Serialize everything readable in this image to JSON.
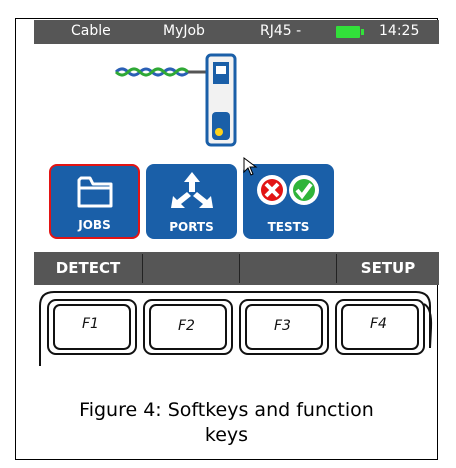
{
  "status_bar": {
    "items": [
      "Cable",
      "MyJob",
      "RJ45 -",
      "14:25"
    ],
    "battery_color": "#32e03a"
  },
  "tiles": [
    {
      "label": "JOBS",
      "icon": "folder-icon",
      "selected": true
    },
    {
      "label": "PORTS",
      "icon": "network-arrows-icon",
      "selected": false
    },
    {
      "label": "TESTS",
      "icon": "pass-fail-icon",
      "selected": false
    }
  ],
  "softkeys": [
    "DETECT",
    "",
    "",
    "SETUP"
  ],
  "function_keys": [
    "F1",
    "F2",
    "F3",
    "F4"
  ],
  "caption": {
    "line1": "Figure 4: Softkeys and function",
    "line2": "keys"
  },
  "colors": {
    "tile_blue": "#1a5fa8",
    "bar_gray": "#565656",
    "selected_border": "#e21414",
    "pass_green": "#2fb43a",
    "fail_red": "#e21414"
  }
}
